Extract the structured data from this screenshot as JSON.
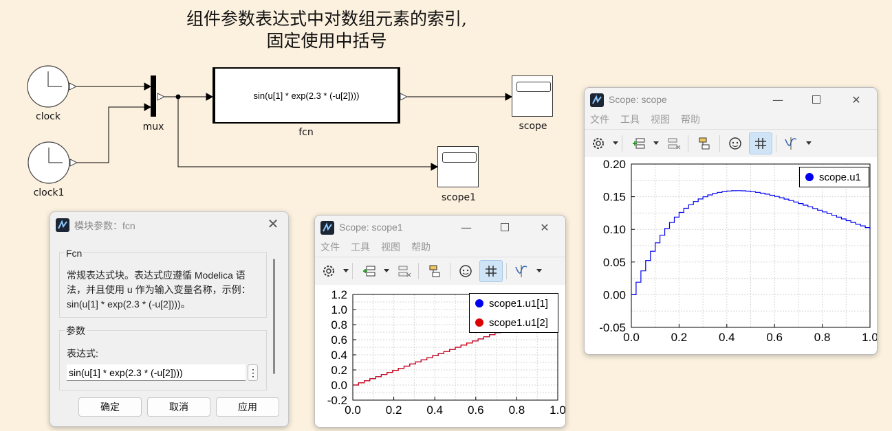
{
  "canvas": {
    "title_line1": "组件参数表达式中对数组元素的索引,",
    "title_line2": "固定使用中括号",
    "blocks": {
      "clock": "clock",
      "clock1": "clock1",
      "mux": "mux",
      "fcn": "fcn",
      "fcn_expr": "sin(u[1] * exp(2.3 * (-u[2])))",
      "scope": "scope",
      "scope1": "scope1"
    }
  },
  "dialog": {
    "title": "模块参数：fcn",
    "group1_title": "Fcn",
    "description": "常规表达式块。表达式应遵循 Modelica 语法，并且使用 u 作为输入变量名称，示例：sin(u[1] * exp(2.3 * (-u[2])))。",
    "group2_title": "参数",
    "field_label": "表达式:",
    "field_value": "sin(u[1] * exp(2.3 * (-u[2])))",
    "ok_label": "确定",
    "cancel_label": "取消",
    "apply_label": "应用"
  },
  "scope1_window": {
    "title": "Scope: scope1",
    "menu": [
      "文件",
      "工具",
      "视图",
      "帮助"
    ],
    "legend": [
      {
        "label": "scope1.u1[1]",
        "color": "#0000ee"
      },
      {
        "label": "scope1.u1[2]",
        "color": "#dd0000"
      }
    ]
  },
  "scope_window": {
    "title": "Scope: scope",
    "menu": [
      "文件",
      "工具",
      "视图",
      "帮助"
    ],
    "legend": [
      {
        "label": "scope.u1",
        "color": "#0000ee"
      }
    ]
  },
  "chart_data": [
    {
      "type": "line",
      "xlim": [
        0.0,
        1.0
      ],
      "ylim": [
        -0.2,
        1.2
      ],
      "xticks": [
        "0.0",
        "0.2",
        "0.4",
        "0.6",
        "0.8",
        "1.0"
      ],
      "yticks": [
        "-0.2",
        "0.0",
        "0.2",
        "0.4",
        "0.6",
        "0.8",
        "1.0",
        "1.2"
      ],
      "grid": true,
      "legend_position": "top-right",
      "series": [
        {
          "name": "scope1.u1[1]",
          "color": "#0000ee",
          "x": [
            0.0,
            1.0
          ],
          "y": [
            0.0,
            1.0
          ]
        },
        {
          "name": "scope1.u1[2]",
          "color": "#dd0000",
          "x": [
            0.0,
            1.0
          ],
          "y": [
            0.0,
            1.0
          ]
        }
      ]
    },
    {
      "type": "line",
      "xlim": [
        0.0,
        1.0
      ],
      "ylim": [
        -0.05,
        0.2
      ],
      "xticks": [
        "0.0",
        "0.2",
        "0.4",
        "0.6",
        "0.8",
        "1.0"
      ],
      "yticks": [
        "-0.05",
        "0.00",
        "0.05",
        "0.10",
        "0.15",
        "0.20"
      ],
      "grid": true,
      "legend_position": "top-right",
      "series": [
        {
          "name": "scope.u1",
          "color": "#0000ee",
          "x": [
            0.0,
            1.0
          ],
          "y": [
            0.0,
            0.1
          ]
        }
      ]
    }
  ]
}
